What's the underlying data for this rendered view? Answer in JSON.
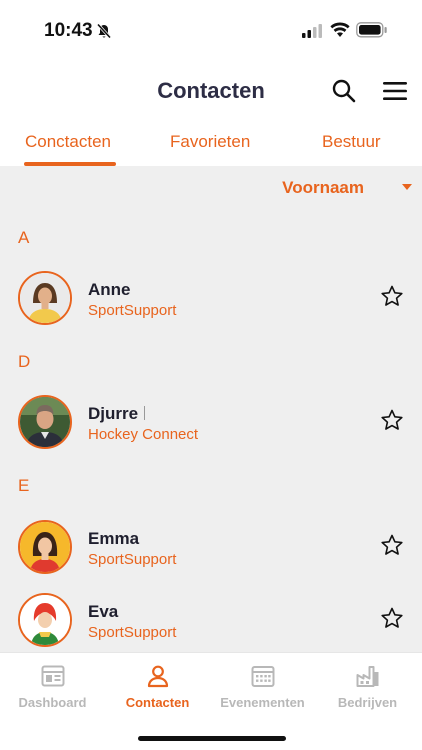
{
  "status_bar": {
    "time": "10:43"
  },
  "header": {
    "title": "Contacten"
  },
  "tabs": [
    {
      "label": "Conctacten",
      "active": true
    },
    {
      "label": "Favorieten",
      "active": false
    },
    {
      "label": "Bestuur",
      "active": false
    }
  ],
  "sort": {
    "label": "Voornaam"
  },
  "sections": [
    {
      "letter": "A",
      "contacts": [
        {
          "name": "Anne",
          "company": "SportSupport"
        }
      ]
    },
    {
      "letter": "D",
      "contacts": [
        {
          "name": "Djurre",
          "company": "Hockey Connect"
        }
      ]
    },
    {
      "letter": "E",
      "contacts": [
        {
          "name": "Emma",
          "company": "SportSupport"
        },
        {
          "name": "Eva",
          "company": "SportSupport"
        }
      ]
    }
  ],
  "bottom_nav": [
    {
      "label": "Dashboard",
      "icon": "dashboard-icon",
      "active": false
    },
    {
      "label": "Contacten",
      "icon": "contacts-icon",
      "active": true
    },
    {
      "label": "Evenementen",
      "icon": "calendar-icon",
      "active": false
    },
    {
      "label": "Bedrijven",
      "icon": "factory-icon",
      "active": false
    }
  ],
  "colors": {
    "accent": "#e8641e",
    "title": "#2d2d45",
    "list_background": "#efefef",
    "inactive_nav": "#b8b8b8"
  }
}
